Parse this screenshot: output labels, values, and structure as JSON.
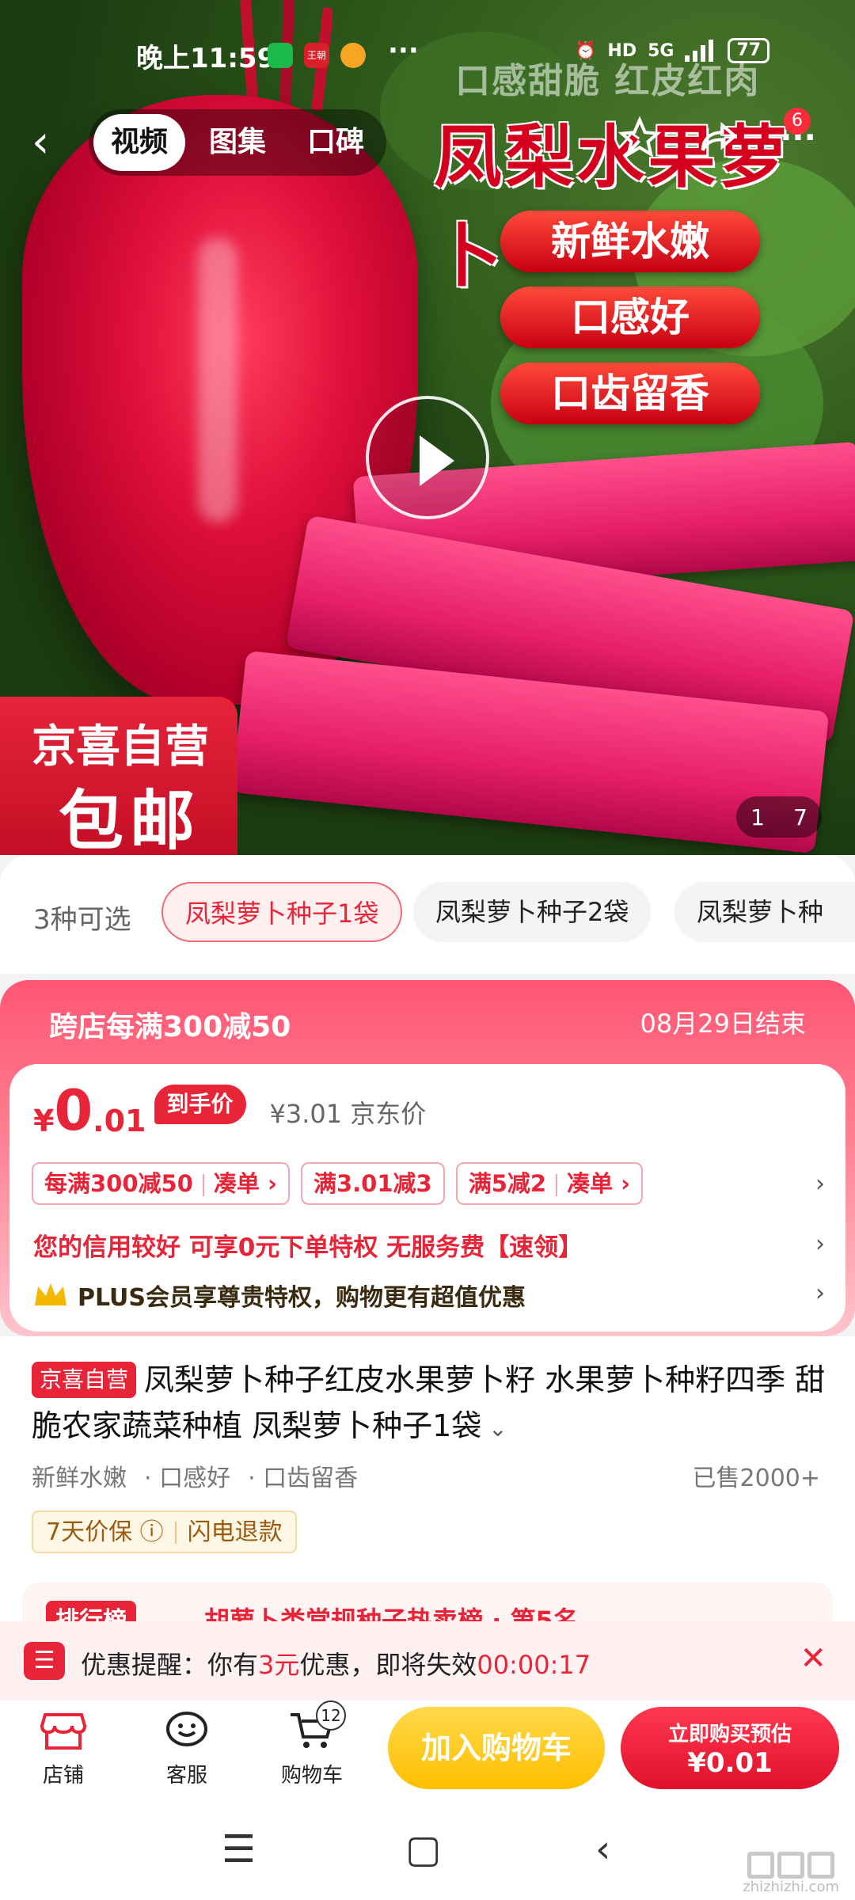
{
  "status_bar": {
    "time": "晚上11:59",
    "dots": "···",
    "network": "5G",
    "hd": "HD",
    "battery": "77",
    "app_badge_text": "王朝"
  },
  "nav": {
    "tabs": [
      "视频",
      "图集",
      "口碑"
    ],
    "active_tab": 0,
    "message_badge": "6"
  },
  "banner": {
    "small_text": "口感甜脆 红皮红肉",
    "title": "凤梨水果萝卜",
    "pills": [
      "新鲜水嫩",
      "口感好",
      "口齿留香"
    ],
    "corner_line1": "京喜自营",
    "corner_line2": "包邮",
    "image_index": "1",
    "image_total": "7"
  },
  "sku": {
    "count_label": "3种可选",
    "options": [
      "凤梨萝卜种子1袋",
      "凤梨萝卜种子2袋",
      "凤梨萝卜种"
    ],
    "selected": 0
  },
  "promo": {
    "header": "跨店每满300减50",
    "ends": "08月29日结束",
    "currency": "¥",
    "price_int": "0",
    "price_dec": ".01",
    "price_tag": "到手价",
    "original": "¥3.01 京东价",
    "coupons": [
      {
        "text": "每满300减50",
        "action": "凑单 ›"
      },
      {
        "text": "满3.01减3",
        "action": ""
      },
      {
        "text": "满5减2",
        "action": "凑单 ›"
      }
    ],
    "credit_text": "您的信用较好 可享0元下单特权 无服务费【速领】",
    "plus_text": "PLUS会员享尊贵特权，购物更有超值优惠"
  },
  "product": {
    "store_tag": "京喜自营",
    "title": "凤梨萝卜种子红皮水果萝卜籽 水果萝卜种籽四季 甜脆农家蔬菜种植 凤梨萝卜种子1袋",
    "features": [
      "新鲜水嫩",
      "· 口感好",
      "· 口齿留香"
    ],
    "sold": "已售2000+",
    "guarantee_1": "7天价保 ⓘ",
    "guarantee_2": "闪电退款",
    "rank_badge": "排行榜",
    "rank_text": "胡萝卜类常规种子热卖榜 · 第5名"
  },
  "reminder": {
    "prefix": "优惠提醒：你有",
    "amount": "3元",
    "middle": "优惠，即将失效",
    "countdown": "00:00:17"
  },
  "actions": {
    "store": "店铺",
    "service": "客服",
    "cart": "购物车",
    "cart_count": "12",
    "add_to_cart": "加入购物车",
    "buy_line1": "立即购买预估",
    "buy_line2": "¥0.01"
  },
  "watermark": "zhizhizhi.com"
}
